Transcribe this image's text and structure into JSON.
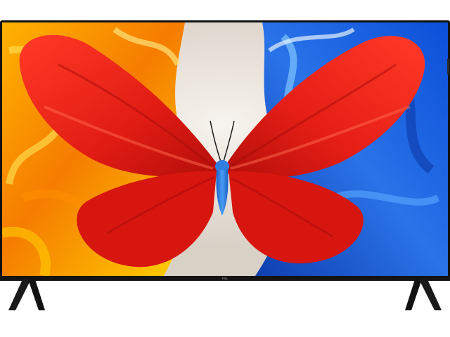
{
  "product": {
    "brand_logo": "TCL",
    "frame_color": "#101010",
    "stand_color": "#1a1a1a"
  },
  "screen": {
    "subject": "butterfly-wallpaper",
    "palette": {
      "wing": "#e8241c",
      "wing_dark": "#b8120e",
      "body": "#2e7de0",
      "left_background": "#f2a500",
      "right_background": "#1f5fd6",
      "center_background": "#ece6de"
    }
  }
}
